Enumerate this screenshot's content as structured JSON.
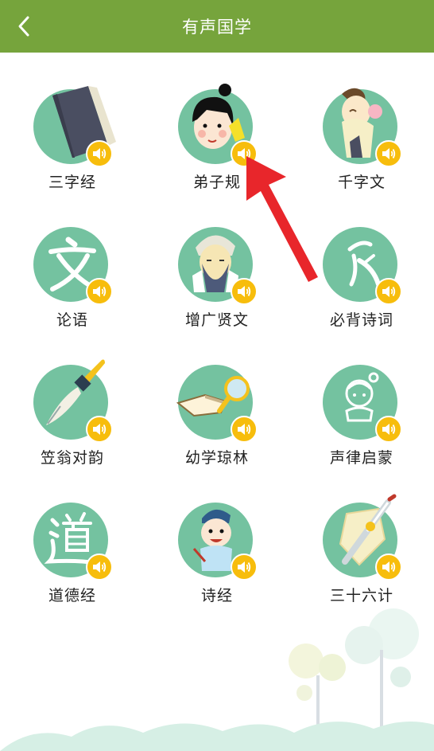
{
  "header": {
    "title": "有声国学",
    "back_icon": "chevron-left-icon"
  },
  "items": [
    {
      "label": "三字经",
      "icon": "book-icon"
    },
    {
      "label": "弟子规",
      "icon": "child-face-icon"
    },
    {
      "label": "千字文",
      "icon": "scholar-icon"
    },
    {
      "label": "论语",
      "icon": "wen-character-icon"
    },
    {
      "label": "增广贤文",
      "icon": "old-sage-icon"
    },
    {
      "label": "必背诗词",
      "icon": "calligraphy-icon"
    },
    {
      "label": "笠翁对韵",
      "icon": "paintbrush-icon"
    },
    {
      "label": "幼学琼林",
      "icon": "open-book-magnifier-icon"
    },
    {
      "label": "声律启蒙",
      "icon": "child-sketch-icon"
    },
    {
      "label": "道德经",
      "icon": "dao-character-icon"
    },
    {
      "label": "诗经",
      "icon": "boy-with-brush-icon"
    },
    {
      "label": "三十六计",
      "icon": "sword-shield-icon"
    }
  ],
  "colors": {
    "header_bg": "#76a43c",
    "icon_blob": "#74c2a0",
    "sound_badge": "#f7bd0c",
    "arrow": "#e8262b"
  }
}
